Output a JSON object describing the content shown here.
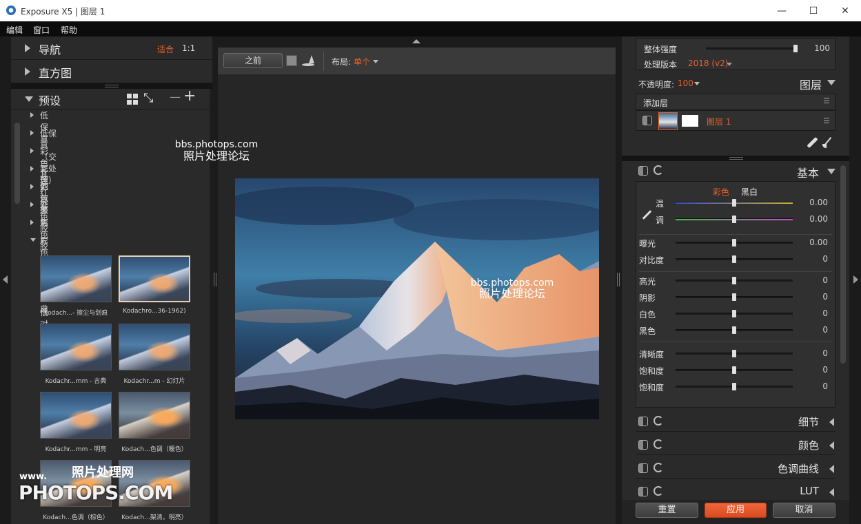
{
  "window": {
    "title": "Exposure X5 | 图层 1",
    "min": "—",
    "max": "☐",
    "close": "✕"
  },
  "menu": [
    "编辑",
    "窗口",
    "帮助"
  ],
  "navigator": {
    "label": "导航",
    "fit": "适合",
    "one_to_one": "1:1"
  },
  "histogram": {
    "label": "直方图"
  },
  "presets": {
    "label": "预设",
    "minus": "—",
    "plus": "+",
    "groups": [
      "低保真",
      "低保真（交叉处理）",
      "彩色其他效果",
      "彩色红外",
      "彩色聚焦",
      "彩色胶片 - 冲印",
      "彩色胶片 - 冲印 - 低对比度",
      "彩色胶片 - 古典"
    ],
    "thumbs": [
      "Kodach...- 擦尘与划痕",
      "Kodachro...36-1962)",
      "Kodachr...mm - 古典",
      "Kodachr...m - 幻灯片",
      "Kodachr...mm - 明亮",
      "Kodach...色调（暖色）",
      "Kodach...色调（棕色）",
      "Kodach...架清，明亮）"
    ]
  },
  "toolbar": {
    "before": "之前",
    "layout_label": "布局:",
    "layout_value": "单个"
  },
  "watermarks": {
    "site": "bbs.photops.com",
    "forum": "照片处理论坛",
    "www": "www.",
    "net": "照片处理网",
    "brand": "PHOTOPS.COM"
  },
  "overall": {
    "intensity_label": "整体强度",
    "intensity_value": "100",
    "intensity_level": 1.0,
    "version_label": "处理版本",
    "version_value": "2018 (v2)"
  },
  "layers": {
    "opacity_label": "不透明度:",
    "opacity_value": "100",
    "title": "图层",
    "add_layer": "添加层",
    "layer_name": "图层 1"
  },
  "basic": {
    "title": "基本",
    "color_tab": "彩色",
    "bw_tab": "黑白",
    "sliders": [
      {
        "label": "温",
        "value": "0.00",
        "level": 0.5
      },
      {
        "label": "调",
        "value": "0.00",
        "level": 0.5
      },
      {
        "label": "曝光",
        "value": "0.00",
        "level": 0.5
      },
      {
        "label": "对比度",
        "value": "0",
        "level": 0.5
      },
      {
        "label": "高光",
        "value": "0",
        "level": 0.5
      },
      {
        "label": "阴影",
        "value": "0",
        "level": 0.5
      },
      {
        "label": "白色",
        "value": "0",
        "level": 0.5
      },
      {
        "label": "黑色",
        "value": "0",
        "level": 0.5
      },
      {
        "label": "清晰度",
        "value": "0",
        "level": 0.5
      },
      {
        "label": "饱和度",
        "value": "0",
        "level": 0.5
      },
      {
        "label": "饱和度",
        "value": "0",
        "level": 0.5
      }
    ]
  },
  "collapsed_panels": [
    "细节",
    "颜色",
    "色调曲线",
    "LUT"
  ],
  "buttons": {
    "reset": "重置",
    "apply": "应用",
    "cancel": "取消"
  },
  "colors": {
    "accent": "#e8602c",
    "bg": "#1b1b1b",
    "panel": "#2a2a2a"
  }
}
